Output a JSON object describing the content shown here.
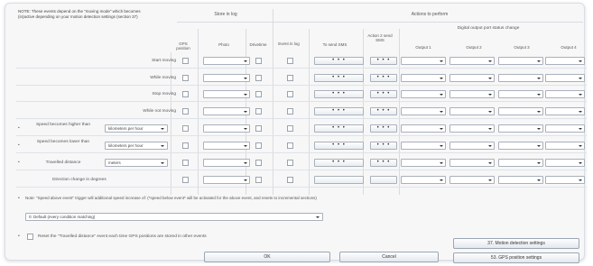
{
  "note": "NOTE: These events depend on the \"moving mode\" which becomes (in)active depending on your motion detection settings (section 37)",
  "sections": {
    "store_in_log": "Store in log",
    "actions": "Actions to perform",
    "digital_output": "Digital output port status change"
  },
  "columns": {
    "gps_position": "GPS position",
    "photo": "Photo",
    "driver": "Drivetime",
    "event_in_log": "Event in log",
    "to_sms": "To send SMS",
    "action_send_sms": "Action 2 send SMS",
    "outputs": [
      "Output 1",
      "Output 2",
      "Output 3",
      "Output 4"
    ]
  },
  "rows": [
    {
      "label": "Start moving"
    },
    {
      "label": "While moving"
    },
    {
      "label": "Stop moving"
    },
    {
      "label": "While not moving"
    },
    {
      "label": "Speed becomes higher than",
      "value": "kilometers per hour"
    },
    {
      "label": "Speed becomes lower than",
      "value": "kilometers per hour"
    },
    {
      "label": "Travelled distance",
      "value": "meters"
    },
    {
      "label": "Direction change in degrees"
    }
  ],
  "dots_label": "• • •",
  "note2": "Note: \"Speed above event\" trigger will additional speed increase of: (*speed below event* will be activated for the above event, and resets to incremental sections)",
  "speed_mode_value": "0: Default (every condition matching)",
  "reset_label": "Reset the \"Travelled distance\" event each time GPS positions are stored in other events",
  "buttons": {
    "motion_settings": "37. Motion detection settings",
    "gps_settings": "53. GPS position settings",
    "ok": "OK",
    "cancel": "Cancel"
  }
}
